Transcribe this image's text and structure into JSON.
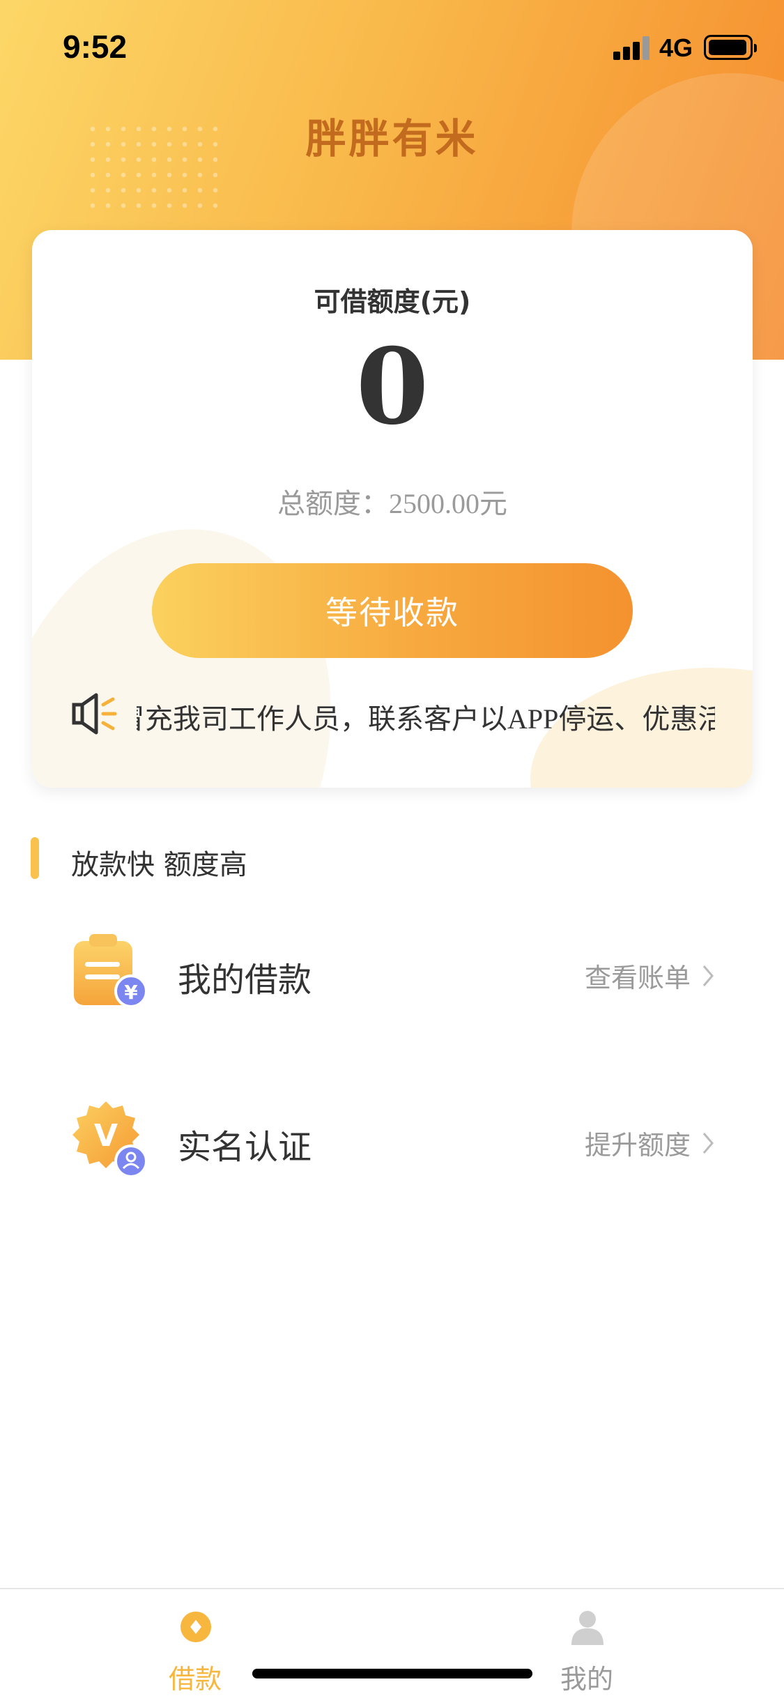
{
  "status_bar": {
    "time": "9:52",
    "network": "4G"
  },
  "header": {
    "title": "胖胖有米"
  },
  "credit_card": {
    "label": "可借额度(元)",
    "available_amount": "0",
    "total_text": "总额度：2500.00元",
    "action_button": "等待收款",
    "notice": "冒充我司工作人员，联系客户以APP停运、优惠活动等为由"
  },
  "section": {
    "title": "放款快 额度高"
  },
  "menu": [
    {
      "label": "我的借款",
      "right_text": "查看账单",
      "icon": "loan-clipboard-icon"
    },
    {
      "label": "实名认证",
      "right_text": "提升额度",
      "icon": "verified-badge-icon"
    }
  ],
  "tab_bar": {
    "items": [
      {
        "label": "借款",
        "icon": "loan-tab-icon",
        "active": true
      },
      {
        "label": "我的",
        "icon": "profile-tab-icon",
        "active": false
      }
    ]
  },
  "colors": {
    "accent": "#f7b63e",
    "title": "#c26a1e",
    "button_start": "#fbd15e",
    "button_end": "#f4922f",
    "verify_badge": "#7b86f0"
  }
}
